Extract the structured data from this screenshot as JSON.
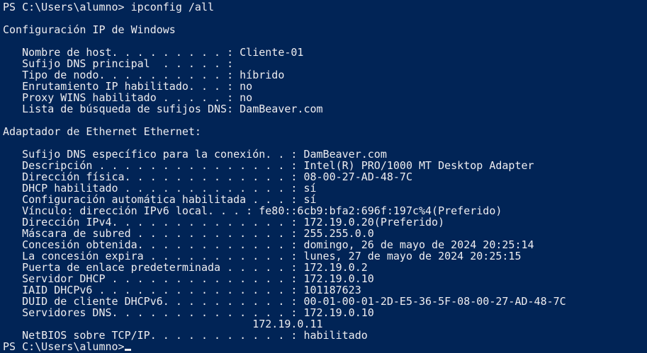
{
  "terminal": {
    "background": "#012456",
    "foreground": "#eeedf0",
    "lines": [
      "PS C:\\Users\\alumno> ipconfig /all",
      "",
      "Configuración IP de Windows",
      "",
      "   Nombre de host. . . . . . . . . : Cliente-01",
      "   Sufijo DNS principal  . . . . . :",
      "   Tipo de nodo. . . . . . . . . . : híbrido",
      "   Enrutamiento IP habilitado. . . : no",
      "   Proxy WINS habilitado . . . . . : no",
      "   Lista de búsqueda de sufijos DNS: DamBeaver.com",
      "",
      "Adaptador de Ethernet Ethernet:",
      "",
      "   Sufijo DNS específico para la conexión. . : DamBeaver.com",
      "   Descripción . . . . . . . . . . . . . . . : Intel(R) PRO/1000 MT Desktop Adapter",
      "   Dirección física. . . . . . . . . . . . . : 08-00-27-AD-48-7C",
      "   DHCP habilitado . . . . . . . . . . . . . : sí",
      "   Configuración automática habilitada . . . : sí",
      "   Vínculo: dirección IPv6 local. . . : fe80::6cb9:bfa2:696f:197c%4(Preferido)",
      "   Dirección IPv4. . . . . . . . . . . . . . : 172.19.0.20(Preferido)",
      "   Máscara de subred . . . . . . . . . . . . : 255.255.0.0",
      "   Concesión obtenida. . . . . . . . . . . . : domingo, 26 de mayo de 2024 20:25:14",
      "   La concesión expira . . . . . . . . . . . : lunes, 27 de mayo de 2024 20:25:15",
      "   Puerta de enlace predeterminada . . . . . : 172.19.0.2",
      "   Servidor DHCP . . . . . . . . . . . . . . : 172.19.0.10",
      "   IAID DHCPv6 . . . . . . . . . . . . . . . : 101187623",
      "   DUID de cliente DHCPv6. . . . . . . . . . : 00-01-00-01-2D-E5-36-5F-08-00-27-AD-48-7C",
      "   Servidores DNS. . . . . . . . . . . . . . : 172.19.0.10",
      "                                       172.19.0.11",
      "   NetBIOS sobre TCP/IP. . . . . . . . . . . : habilitado",
      "PS C:\\Users\\alumno>"
    ]
  }
}
